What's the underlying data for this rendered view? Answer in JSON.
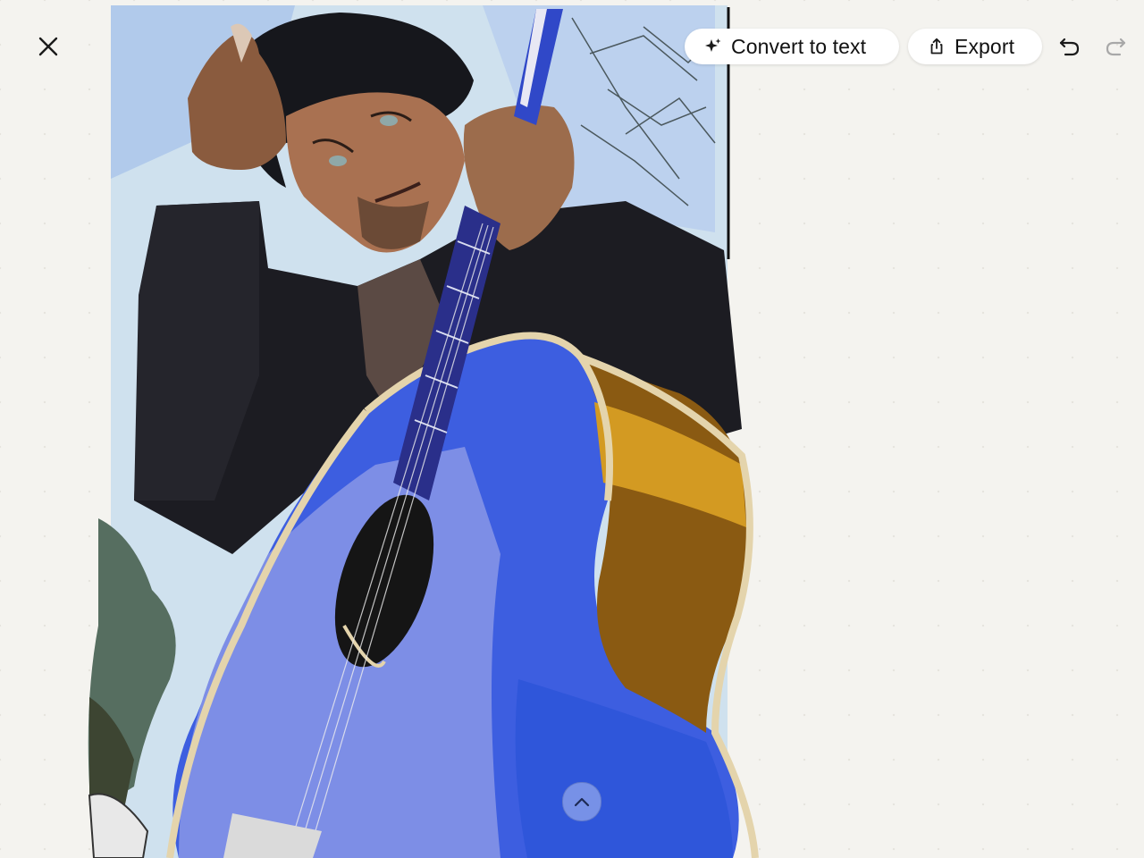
{
  "toolbar": {
    "close_icon": "close-icon",
    "convert_label": "Convert to text",
    "convert_icon": "sparkle-icon",
    "export_label": "Export",
    "export_icon": "share-icon",
    "undo_icon": "undo-icon",
    "redo_icon": "redo-icon"
  },
  "canvas": {
    "background_color": "#f4f3ef",
    "artwork_subject": "illustration-guitarist",
    "collapse_icon": "chevron-up-icon"
  },
  "colors": {
    "guitar_blue": "#2e4fd8",
    "guitar_amber": "#b07814",
    "jacket": "#1a1a1f",
    "sky": "#c9dcec"
  }
}
